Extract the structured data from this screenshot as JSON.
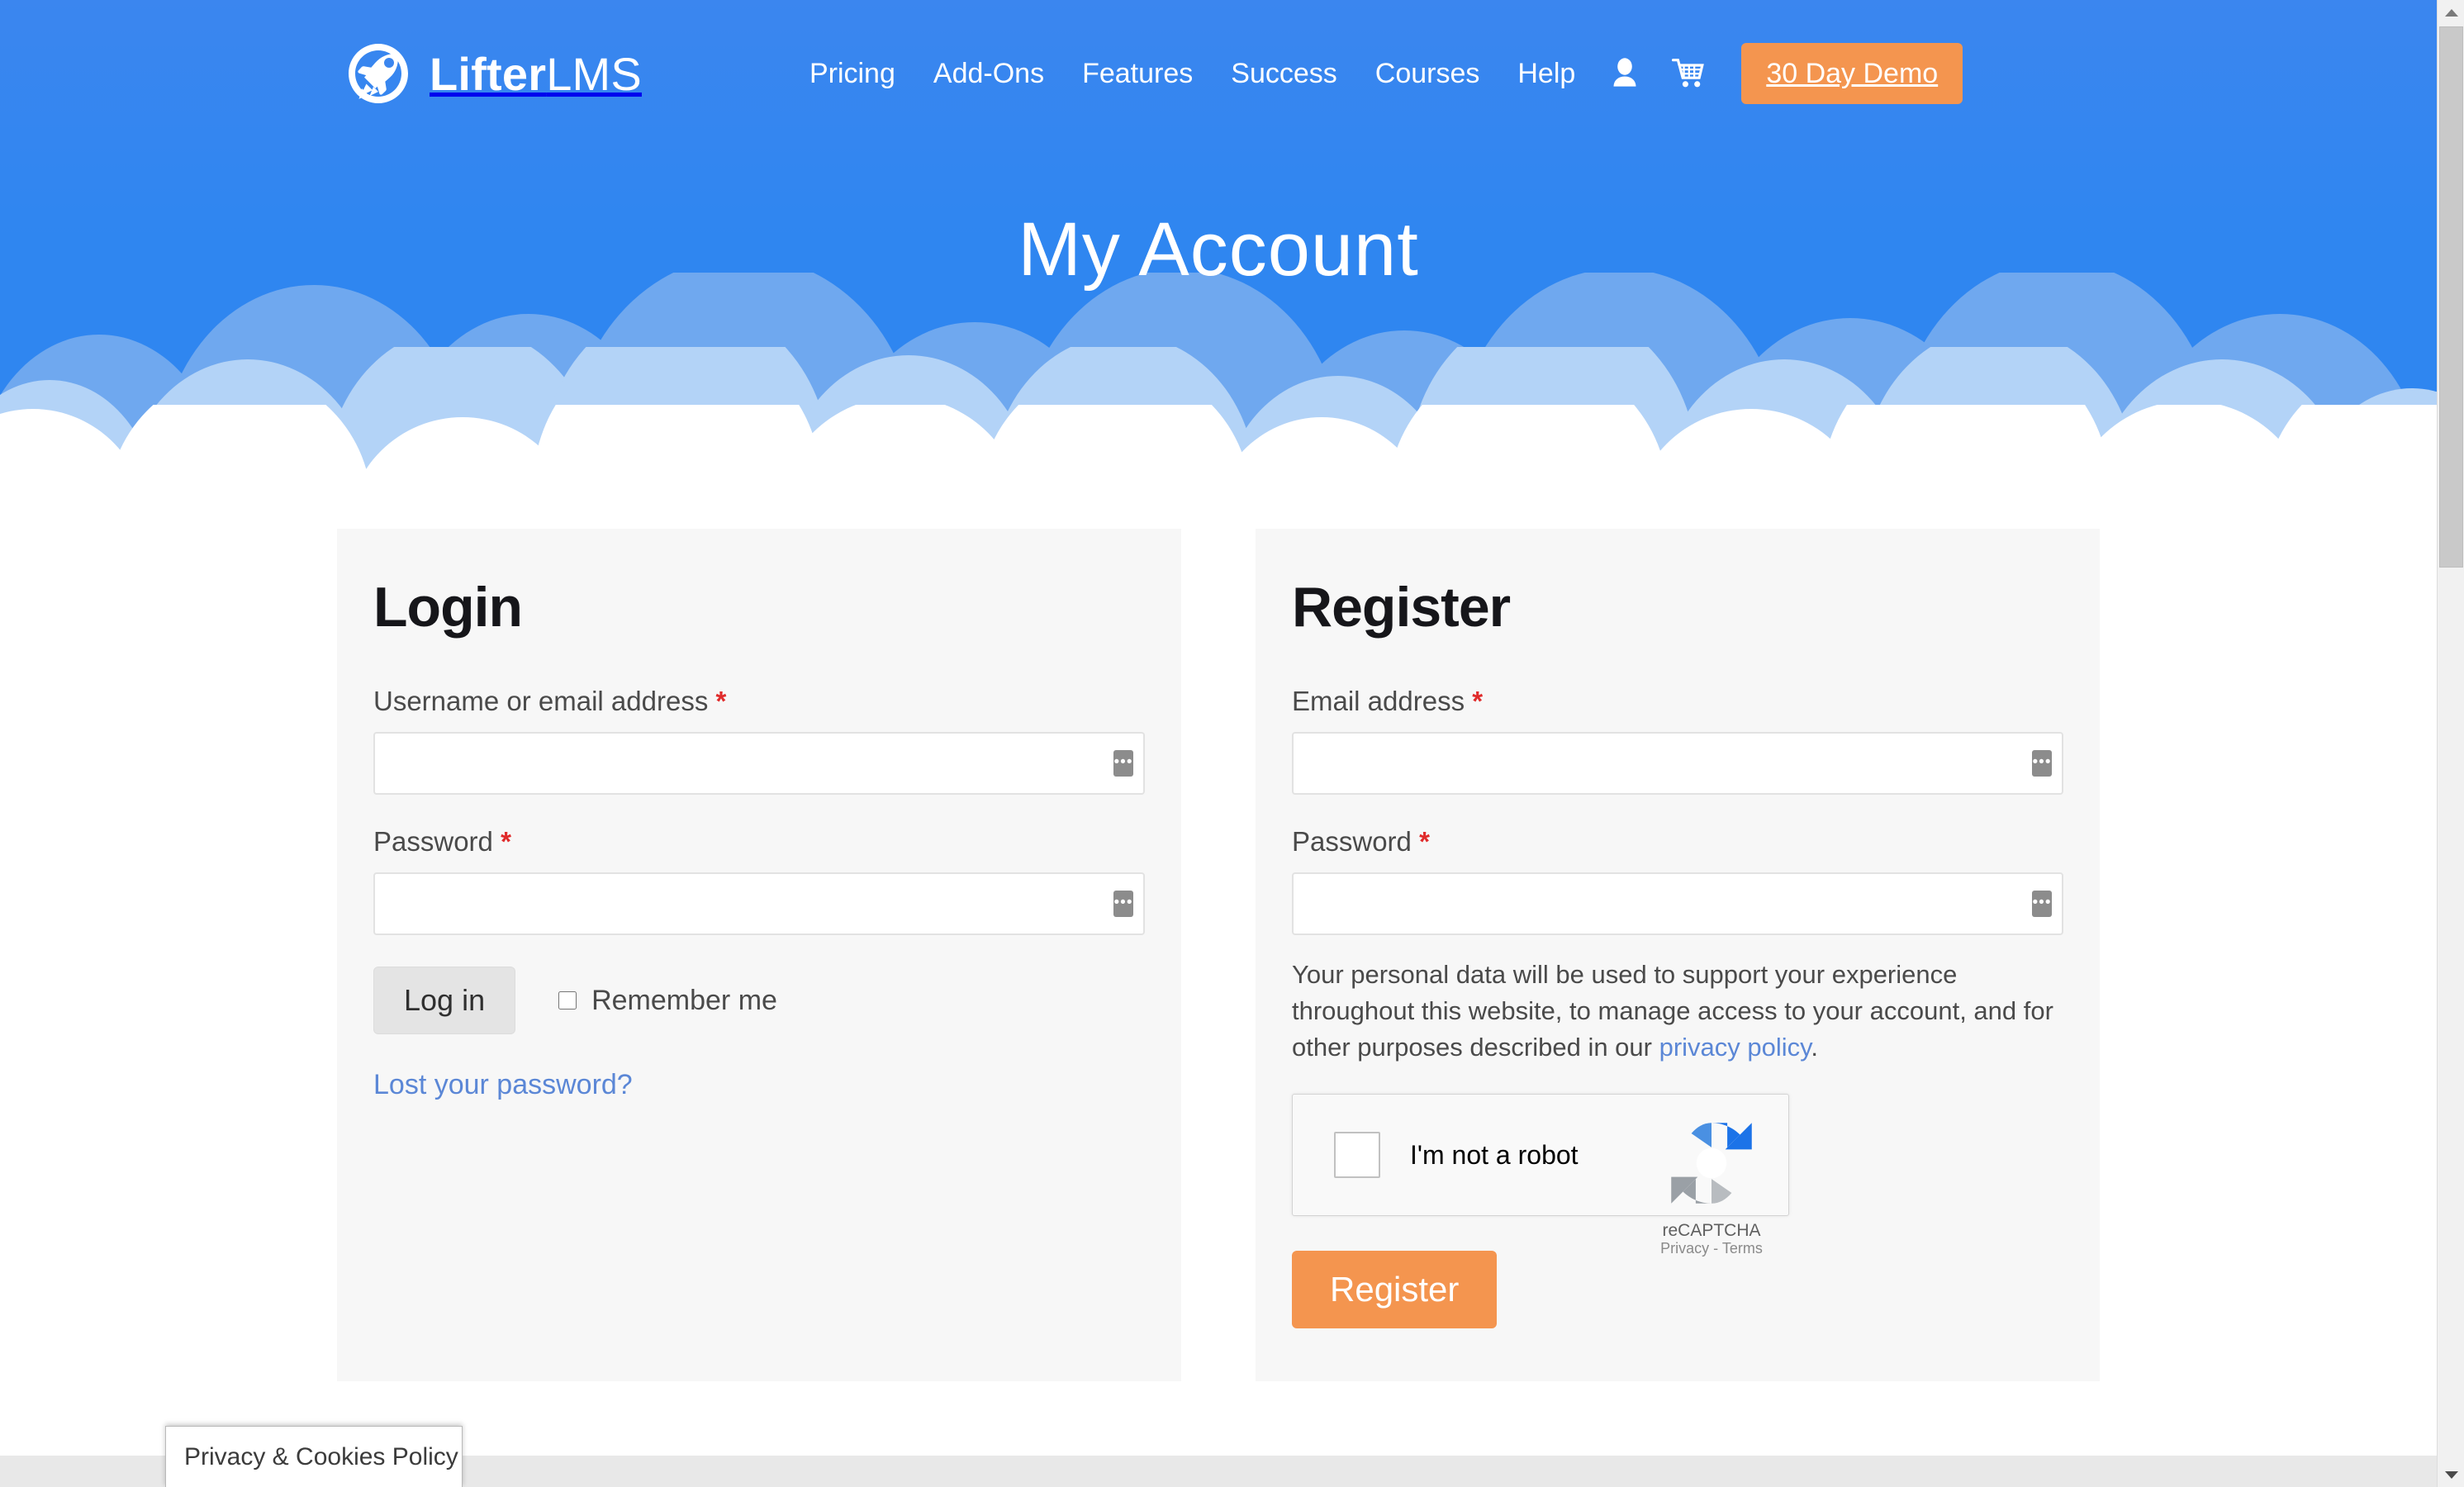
{
  "brand": {
    "name_bold": "Lifter",
    "name_light": "LMS",
    "logo_icon": "rocket-circle-icon"
  },
  "nav": {
    "links": [
      {
        "label": "Pricing"
      },
      {
        "label": "Add-Ons"
      },
      {
        "label": "Features"
      },
      {
        "label": "Success"
      },
      {
        "label": "Courses"
      },
      {
        "label": "Help"
      }
    ],
    "account_icon": "user-icon",
    "cart_icon": "shopping-cart-icon",
    "cta_label": "30 Day Demo",
    "cta_color": "#f4954f"
  },
  "hero": {
    "title": "My Account",
    "sky_color": "#2f86f0",
    "cloud_dark": "#6fa8ef",
    "cloud_mid": "#b3d3f7",
    "cloud_light": "#ffffff"
  },
  "login": {
    "title": "Login",
    "username_label": "Username or email address",
    "username_required": "*",
    "username_value": "",
    "username_placeholder": "",
    "password_label": "Password",
    "password_required": "*",
    "password_value": "",
    "password_placeholder": "",
    "submit_label": "Log in",
    "remember_label": "Remember me",
    "remember_checked": false,
    "lost_password_label": "Lost your password?",
    "autofill_icon": "autofill-dots-icon"
  },
  "register": {
    "title": "Register",
    "email_label": "Email address",
    "email_required": "*",
    "email_value": "",
    "email_placeholder": "",
    "password_label": "Password",
    "password_required": "*",
    "password_value": "",
    "password_placeholder": "",
    "privacy_text_before": "Your personal data will be used to support your experience throughout this website, to manage access to your account, and for other purposes described in our ",
    "privacy_link_label": "privacy policy",
    "privacy_text_after": ".",
    "submit_label": "Register",
    "autofill_icon": "autofill-dots-icon"
  },
  "recaptcha": {
    "checkbox_label": "I'm not a robot",
    "checked": false,
    "brand_name": "reCAPTCHA",
    "terms": "Privacy - Terms",
    "logo_icon": "recaptcha-logo-icon"
  },
  "cookies": {
    "label": "Privacy & Cookies Policy"
  },
  "scrollbar": {
    "up_icon": "scroll-up-arrow-icon",
    "down_icon": "scroll-down-arrow-icon"
  }
}
